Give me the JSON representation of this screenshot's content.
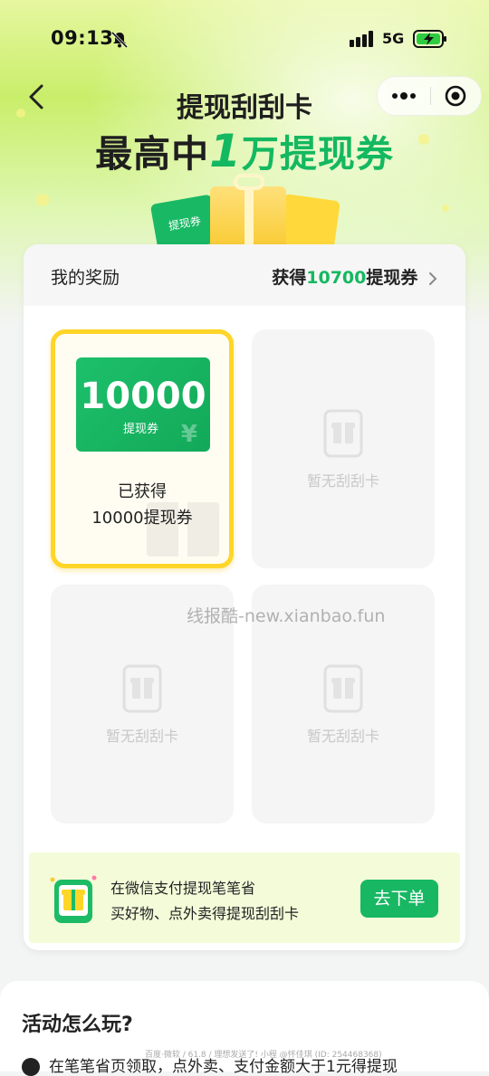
{
  "status_bar": {
    "time": "09:13",
    "network": "5G",
    "icons": [
      "mute-icon",
      "signal-icon",
      "battery-charging-icon"
    ]
  },
  "nav": {
    "back_icon": "chevron-left-icon",
    "more_icon": "more-dots-icon",
    "close_icon": "target-circle-icon"
  },
  "hero": {
    "title_line1": "提现刮刮卡",
    "title_line2_prefix": "最高中",
    "title_line2_big": "1",
    "title_line2_suffix": "万提现券",
    "ticket_label": "提现券"
  },
  "rewards": {
    "header_title": "我的奖励",
    "summary_prefix": "获得",
    "summary_amount": "10700",
    "summary_suffix": "提现券",
    "cards": [
      {
        "state": "won",
        "voucher_amount": "10000",
        "voucher_unit": "提现券",
        "voucher_symbol": "¥",
        "line1": "已获得",
        "line2": "10000提现券"
      },
      {
        "state": "empty",
        "label": "暂无刮刮卡"
      },
      {
        "state": "empty",
        "label": "暂无刮刮卡"
      },
      {
        "state": "empty",
        "label": "暂无刮刮卡"
      }
    ]
  },
  "watermark": "线报酷-new.xianbao.fun",
  "promo": {
    "line1": "在微信支付提现笔笔省",
    "line2": "买好物、点外卖得提现刮刮卡",
    "button": "去下单"
  },
  "howto": {
    "title": "活动怎么玩?",
    "step1": "在笔笔省页领取，点外卖、支付金额大于1元得提现"
  },
  "footer_credit": "百度·微软 / 61.8 / 理想发送了! 小程 @怀佳琪 (ID: 254468368)",
  "colors": {
    "accent_green": "#14b860",
    "gold_border": "#ffd528",
    "promo_bg": "#f3fbd9"
  }
}
